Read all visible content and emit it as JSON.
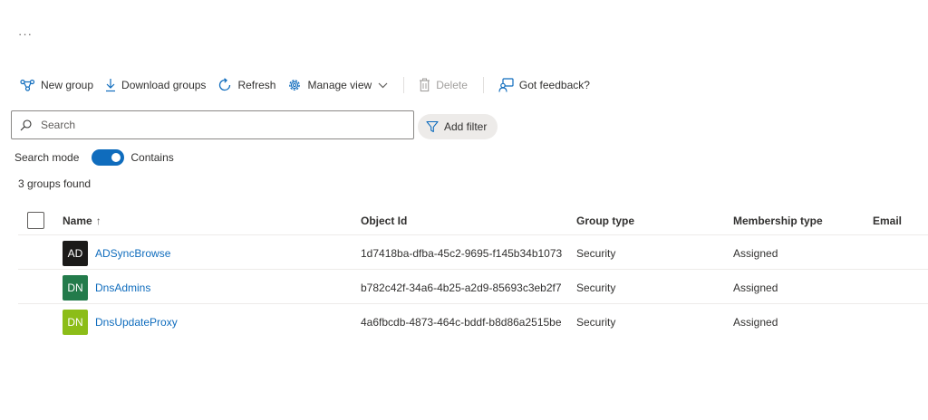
{
  "header": {
    "more_glyph": "···"
  },
  "toolbar": {
    "new_group": "New group",
    "download_groups": "Download groups",
    "refresh": "Refresh",
    "manage_view": "Manage view",
    "delete": "Delete",
    "feedback": "Got feedback?"
  },
  "search": {
    "placeholder": "Search",
    "value": ""
  },
  "filter": {
    "label": "Add filter"
  },
  "search_mode": {
    "label": "Search mode",
    "value": "Contains",
    "enabled": true
  },
  "results": {
    "count_text": "3 groups found"
  },
  "table": {
    "columns": {
      "name": "Name",
      "sort_indicator": "↑",
      "object_id": "Object Id",
      "group_type": "Group type",
      "membership_type": "Membership type",
      "email": "Email"
    },
    "rows": [
      {
        "initials": "AD",
        "avatar_color": "#1b1a19",
        "name": "ADSyncBrowse",
        "object_id": "1d7418ba-dfba-45c2-9695-f145b34b1073",
        "group_type": "Security",
        "membership_type": "Assigned",
        "email": ""
      },
      {
        "initials": "DN",
        "avatar_color": "#237b4b",
        "name": "DnsAdmins",
        "object_id": "b782c42f-34a6-4b25-a2d9-85693c3eb2f7",
        "group_type": "Security",
        "membership_type": "Assigned",
        "email": ""
      },
      {
        "initials": "DN",
        "avatar_color": "#8cbd18",
        "name": "DnsUpdateProxy",
        "object_id": "4a6fbcdb-4873-464c-bddf-b8d86a2515be",
        "group_type": "Security",
        "membership_type": "Assigned",
        "email": ""
      }
    ]
  },
  "colors": {
    "accent": "#0f6cbd",
    "text": "#323130",
    "border": "#8a8886",
    "pill_bg": "#edebe9"
  }
}
